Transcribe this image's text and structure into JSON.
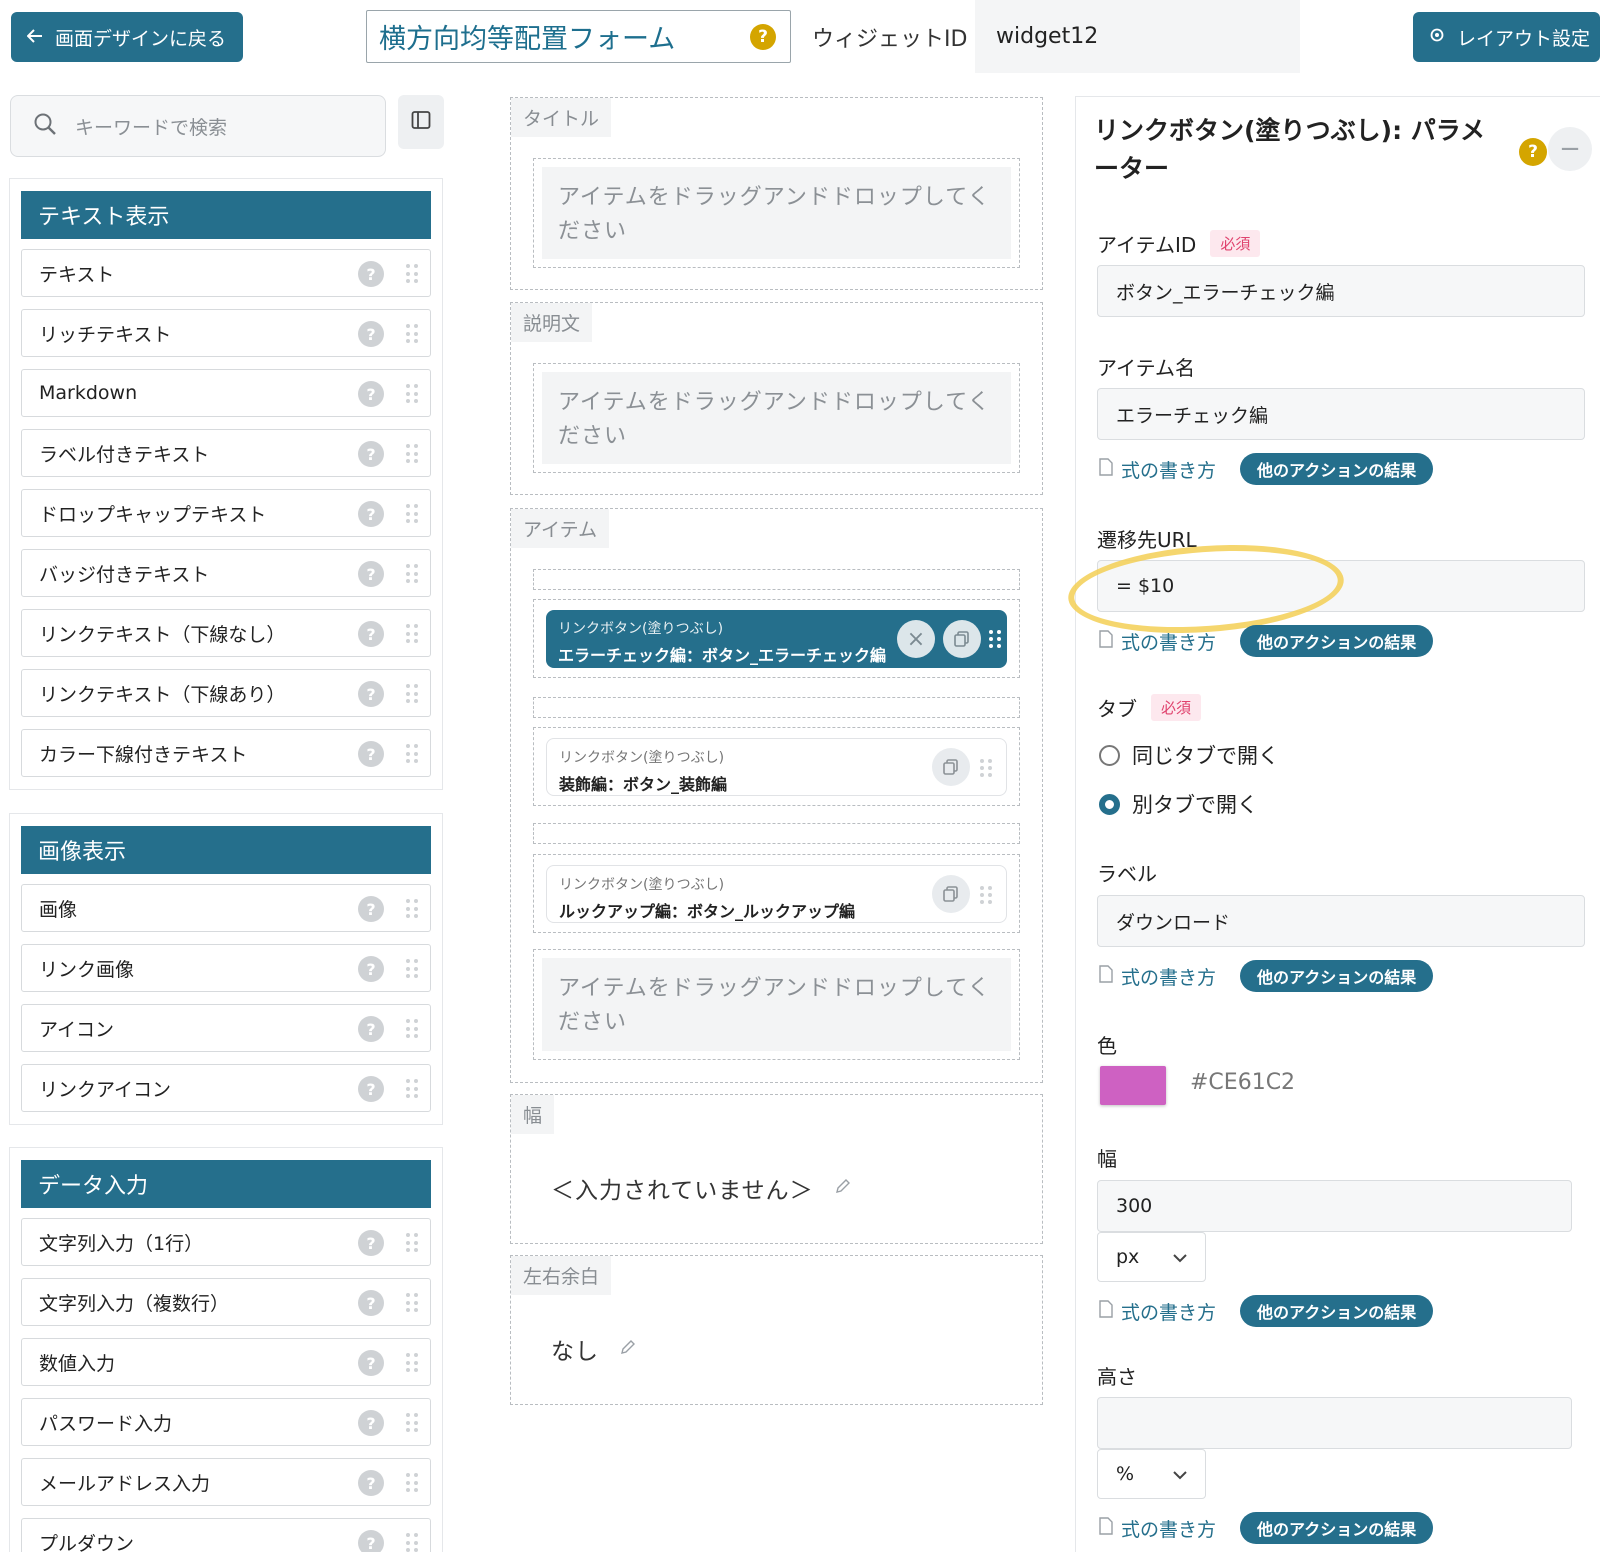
{
  "topbar": {
    "back_label": "画面デザインに戻る",
    "form_title": "横方向均等配置フォーム",
    "widget_id_label": "ウィジェットID",
    "widget_id_value": "widget12",
    "layout_label": "レイアウト設定"
  },
  "sidebar": {
    "search_placeholder": "キーワードで検索",
    "groups": [
      {
        "title": "テキスト表示",
        "items": [
          "テキスト",
          "リッチテキスト",
          "Markdown",
          "ラベル付きテキスト",
          "ドロップキャップテキスト",
          "バッジ付きテキスト",
          "リンクテキスト（下線なし）",
          "リンクテキスト（下線あり）",
          "カラー下線付きテキスト"
        ]
      },
      {
        "title": "画像表示",
        "items": [
          "画像",
          "リンク画像",
          "アイコン",
          "リンクアイコン"
        ]
      },
      {
        "title": "データ入力",
        "items": [
          "文字列入力（1行）",
          "文字列入力（複数行）",
          "数値入力",
          "パスワード入力",
          "メールアドレス入力",
          "プルダウン"
        ]
      }
    ],
    "help_glyph": "?"
  },
  "canvas": {
    "title_label": "タイトル",
    "desc_label": "説明文",
    "items_label": "アイテム",
    "width_label": "幅",
    "margin_label": "左右余白",
    "drop_placeholder": "アイテムをドラッグアンドドロップしてください",
    "cards": [
      {
        "type": "リンクボタン(塗りつぶし)",
        "text": "エラーチェック編：ボタン_エラーチェック編",
        "active": true
      },
      {
        "type": "リンクボタン(塗りつぶし)",
        "text": "装飾編：ボタン_装飾編",
        "active": false
      },
      {
        "type": "リンクボタン(塗りつぶし)",
        "text": "ルックアップ編：ボタン_ルックアップ編",
        "active": false
      }
    ],
    "width_value": "＜入力されていません＞",
    "margin_value": "なし"
  },
  "params": {
    "title": "リンクボタン(塗りつぶし): パラメーター",
    "required_badge": "必須",
    "item_id_label": "アイテムID",
    "item_id_value": "ボタン_エラーチェック編",
    "item_name_label": "アイテム名",
    "item_name_value": "エラーチェック編",
    "formula_link": "式の書き方",
    "other_result": "他のアクションの結果",
    "url_label": "遷移先URL",
    "url_value": "= $10",
    "tab_label": "タブ",
    "tab_same": "同じタブで開く",
    "tab_new": "別タブで開く",
    "button_label_label": "ラベル",
    "button_label_value": "ダウンロード",
    "color_label": "色",
    "color_hex": "#CE61C2",
    "width_label": "幅",
    "width_value": "300",
    "width_unit": "px",
    "height_label": "高さ",
    "height_value": "",
    "height_unit": "%"
  },
  "colors": {
    "accent": "#256f8c",
    "swatch": "#CE61C2",
    "help": "#d4a500",
    "annotation": "#f3cf55"
  }
}
